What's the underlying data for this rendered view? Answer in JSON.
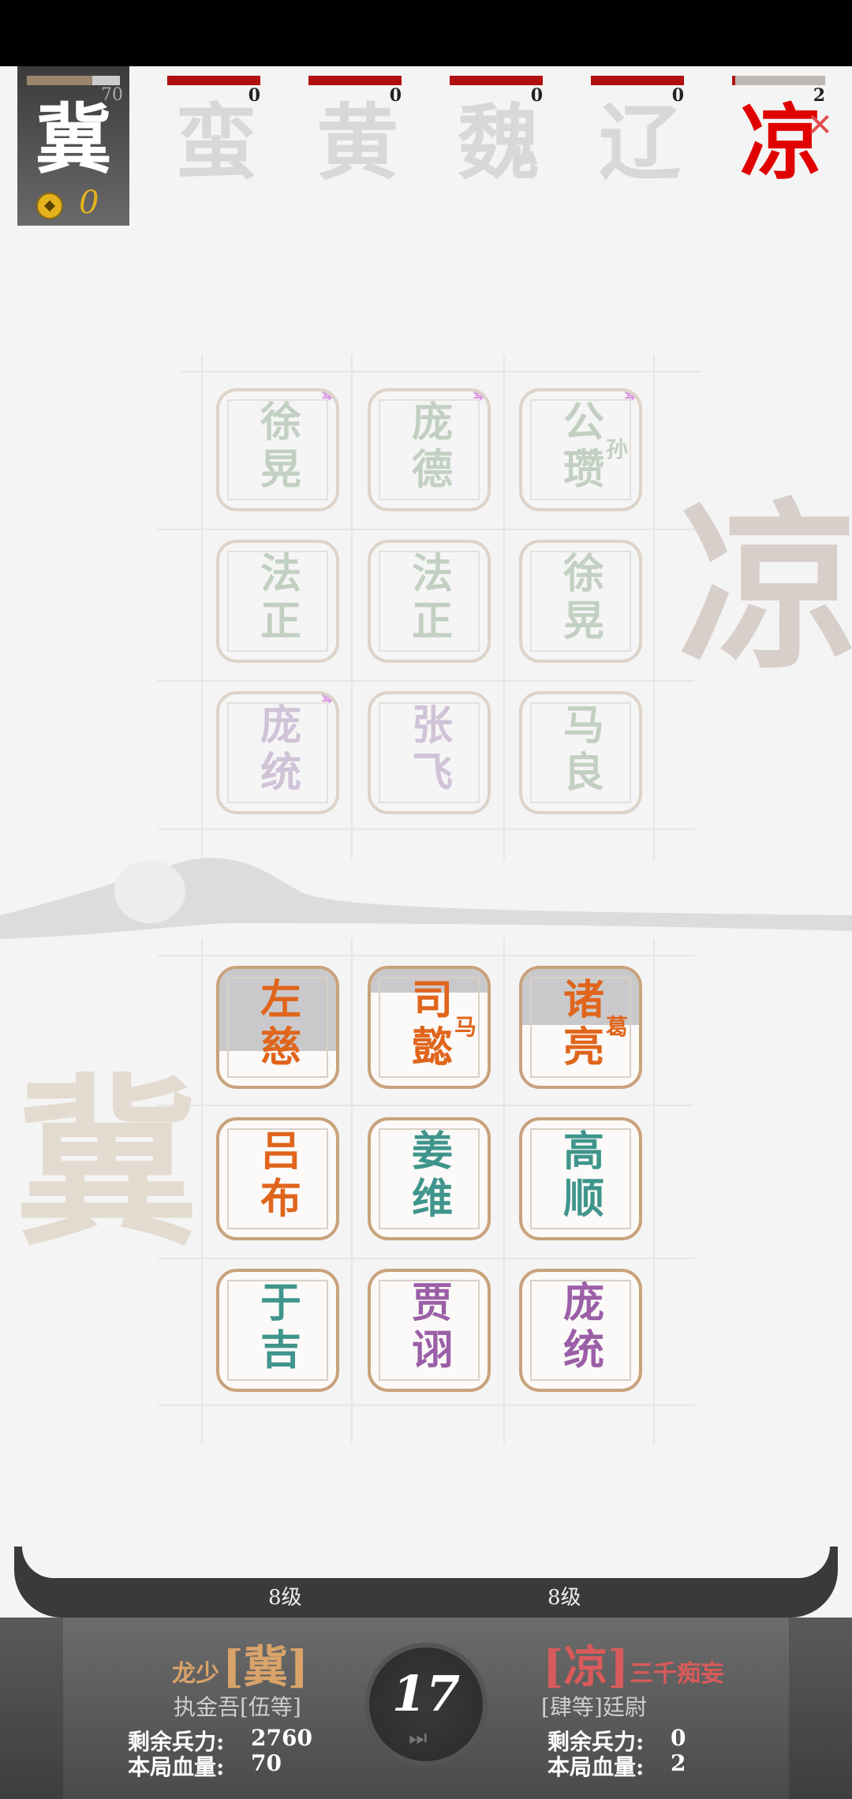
{
  "player": {
    "faction_char": "冀",
    "hp_value": "70",
    "hp_fraction": 0.7,
    "coins": "0"
  },
  "factions": [
    {
      "char": "蛮",
      "count": "0",
      "hp_fraction": 0,
      "enemy": false
    },
    {
      "char": "黄",
      "count": "0",
      "hp_fraction": 0,
      "enemy": false
    },
    {
      "char": "魏",
      "count": "0",
      "hp_fraction": 0,
      "enemy": false
    },
    {
      "char": "辽",
      "count": "0",
      "hp_fraction": 0,
      "enemy": false
    },
    {
      "char": "凉",
      "count": "2",
      "hp_fraction": 0.03,
      "enemy": true,
      "defeated_mark": "✕"
    }
  ],
  "board": {
    "enemy_watermark": "凉",
    "player_watermark": "冀",
    "enemy_tiles": [
      {
        "l1": "徐",
        "l2": "晃",
        "sub": "",
        "color": "#9bb39b",
        "flag": "晕"
      },
      {
        "l1": "庞",
        "l2": "德",
        "sub": "",
        "color": "#9bb39b",
        "flag": "晕"
      },
      {
        "l1": "公",
        "l2": "瓒",
        "sub": "孙",
        "color": "#9bb39b",
        "flag": "晕"
      },
      {
        "l1": "法",
        "l2": "正",
        "sub": "",
        "color": "#9bb39b",
        "flag": ""
      },
      {
        "l1": "法",
        "l2": "正",
        "sub": "",
        "color": "#9bb39b",
        "flag": ""
      },
      {
        "l1": "徐",
        "l2": "晃",
        "sub": "",
        "color": "#9bb39b",
        "flag": ""
      },
      {
        "l1": "庞",
        "l2": "统",
        "sub": "",
        "color": "#b39ac1",
        "flag": "晕"
      },
      {
        "l1": "张",
        "l2": "飞",
        "sub": "",
        "color": "#b39ac1",
        "flag": ""
      },
      {
        "l1": "马",
        "l2": "良",
        "sub": "",
        "color": "#9bb39b",
        "flag": ""
      }
    ],
    "player_tiles": [
      {
        "l1": "左",
        "l2": "慈",
        "sub": "",
        "color": "#e0651c",
        "shade": 0.7
      },
      {
        "l1": "司",
        "l2": "懿",
        "sub": "马",
        "color": "#e0651c",
        "shade": 0.2
      },
      {
        "l1": "诸",
        "l2": "亮",
        "sub": "葛",
        "color": "#e0651c",
        "shade": 0.5
      },
      {
        "l1": "吕",
        "l2": "布",
        "sub": "",
        "color": "#e0651c",
        "shade": 0
      },
      {
        "l1": "姜",
        "l2": "维",
        "sub": "",
        "color": "#3f958c",
        "shade": 0
      },
      {
        "l1": "高",
        "l2": "顺",
        "sub": "",
        "color": "#3f958c",
        "shade": 0
      },
      {
        "l1": "于",
        "l2": "吉",
        "sub": "",
        "color": "#3f958c",
        "shade": 0
      },
      {
        "l1": "贾",
        "l2": "诩",
        "sub": "",
        "color": "#9b5fa8",
        "shade": 0
      },
      {
        "l1": "庞",
        "l2": "统",
        "sub": "",
        "color": "#9b5fa8",
        "shade": 0
      }
    ]
  },
  "levels": {
    "left": "8级",
    "right": "8级"
  },
  "left_player": {
    "name": "龙少",
    "faction": "[冀]",
    "rank": "执金吾[伍等]",
    "troops_label": "剩余兵力:",
    "troops_value": "2760",
    "hp_label": "本局血量:",
    "hp_value": "70"
  },
  "right_player": {
    "name": "三千痴妄",
    "faction": "[凉]",
    "rank": "[肆等]廷尉",
    "troops_label": "剩余兵力:",
    "troops_value": "0",
    "hp_label": "本局血量:",
    "hp_value": "2"
  },
  "turn": {
    "number": "17",
    "skip_icon": "skip-forward-icon"
  },
  "colors": {
    "left_accent": "#d9a36a",
    "right_accent": "#d95a5a"
  }
}
